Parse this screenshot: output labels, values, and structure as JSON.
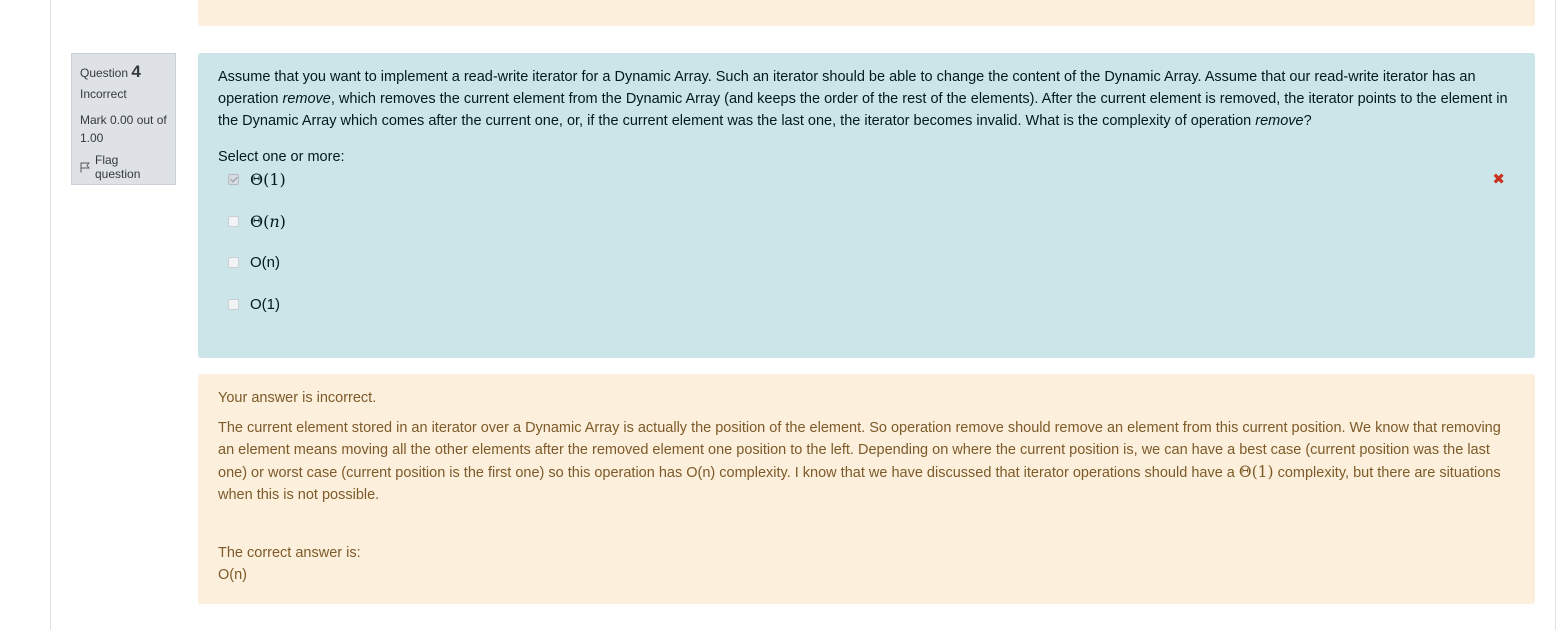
{
  "question_info": {
    "question_label": "Question",
    "question_number": "4",
    "state": "Incorrect",
    "grade_line1": "Mark 0.00 out of",
    "grade_line2": "1.00",
    "flag_label": "Flag question"
  },
  "question": {
    "text_part1": "Assume that you want to implement a read-write iterator for a Dynamic Array. Such an iterator should be able to change the content of the Dynamic Array. Assume that our read-write iterator has an operation ",
    "text_em1": "remove",
    "text_part2": ", which removes the current element from the Dynamic Array (and keeps the order of the rest of the elements). After the current element is removed, the iterator points to the element in the Dynamic Array which comes after the current one, or, if the current element was the last one, the iterator becomes invalid. What is the complexity of operation ",
    "text_em2": "remove",
    "text_part3": "?",
    "prompt": "Select one or more:",
    "options": [
      {
        "prefix": "Θ(",
        "var": "1",
        "suffix": ")",
        "checked": true,
        "math": true,
        "mark": "✖"
      },
      {
        "prefix": "Θ(",
        "var": "n",
        "suffix": ")",
        "checked": false,
        "math": true
      },
      {
        "label": "O(n)",
        "checked": false,
        "math": false
      },
      {
        "label": "O(1)",
        "checked": false,
        "math": false
      }
    ]
  },
  "feedback": {
    "specific": "Your answer is incorrect.",
    "general_part1": "The current element stored in an iterator over a Dynamic Array is actually the position of the element. So operation remove should remove an element from this current position. We know that removing an element means moving all the other elements after the removed element one position to the left. Depending on where the current position is, we can have a best case (current position was the last one) or worst case (current position is the first one) so this operation has O(n) complexity. I know that we have discussed that iterator operations should have a ",
    "general_math": "Θ(1)",
    "general_part2": " complexity, but there are situations when this is not possible.",
    "right_answer_label": "The correct answer is:",
    "right_answer_value": "O(n)"
  },
  "colors": {
    "formulation_bg": "#cce5e9",
    "feedback_bg": "#fcefdc",
    "feedback_text": "#7d5a29",
    "incorrect_mark": "#ca3120",
    "info_bg": "#dee2e6"
  }
}
